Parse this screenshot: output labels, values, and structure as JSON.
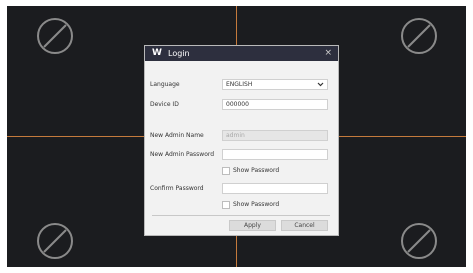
{
  "dialog": {
    "logo": "W",
    "title": "Login",
    "close_glyph": "×",
    "language_label": "Language",
    "language_value": "ENGLISH",
    "device_id_label": "Device ID",
    "device_id_value": "000000",
    "new_admin_name_label": "New Admin Name",
    "new_admin_name_value": "admin",
    "new_admin_password_label": "New Admin Password",
    "show_password_1": "Show Password",
    "confirm_password_label": "Confirm Password",
    "show_password_2": "Show Password",
    "apply_label": "Apply",
    "cancel_label": "Cancel"
  },
  "icons": {
    "channel_placeholder": "no-video-icon",
    "dropdown": "chevron-down-icon"
  },
  "colors": {
    "grid_line": "#c47a3c",
    "title_bar": "#2d2f3e",
    "screen_bg": "#1c1d20"
  }
}
